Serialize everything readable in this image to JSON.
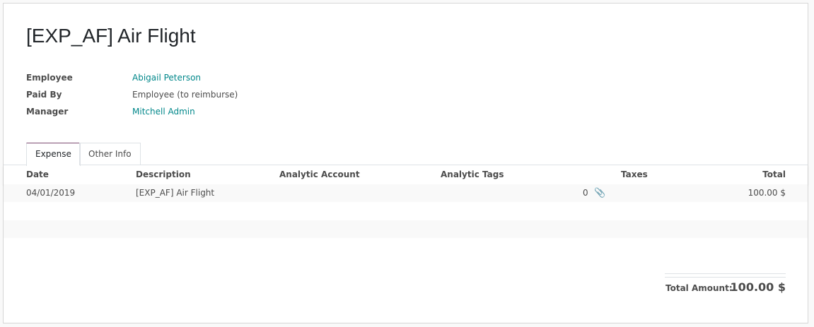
{
  "title": "[EXP_AF] Air Flight",
  "fields": [
    {
      "label": "Employee",
      "value": "Abigail Peterson"
    },
    {
      "label": "Paid By",
      "value": "Employee (to reimburse)"
    },
    {
      "label": "Manager",
      "value": "Mitchell Admin"
    }
  ],
  "tabs": [
    {
      "label": "Expense"
    },
    {
      "label": "Other Info"
    }
  ],
  "table": {
    "columns": [
      "Date",
      "Description",
      "Analytic Account",
      "Analytic Tags",
      "Taxes",
      "Total"
    ],
    "rows": [
      {
        "date": "04/01/2019",
        "description": "[EXP_AF] Air Flight",
        "analytic_account": "",
        "analytic_tags": "",
        "attachments": "0",
        "total": "100.00 $"
      }
    ]
  },
  "total_label": "Total Amount:",
  "total_value": "100.00 $",
  "colors": {
    "link": "#00878a",
    "active_tab": "#7c4a72"
  }
}
